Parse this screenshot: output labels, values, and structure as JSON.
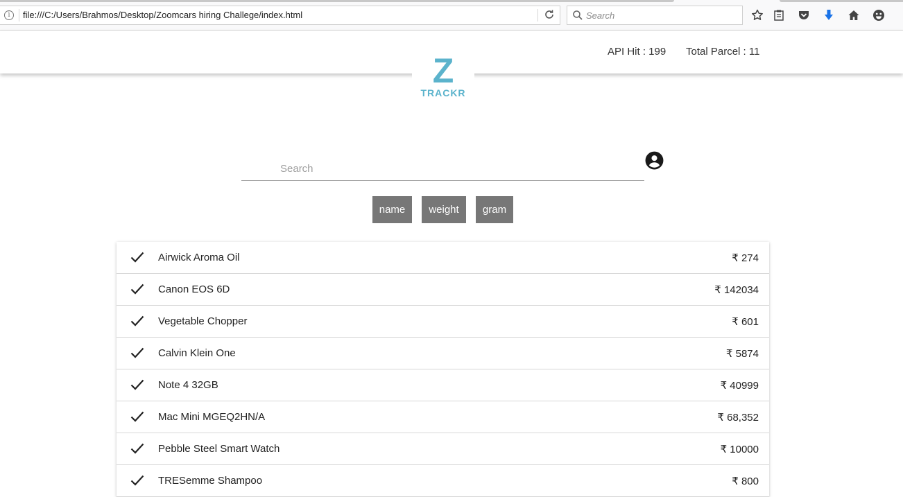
{
  "browser": {
    "url": "file:///C:/Users/Brahmos/Desktop/Zoomcars hiring Challege/index.html",
    "search_placeholder": "Search",
    "icons": [
      "info-icon",
      "reload-icon",
      "search-icon",
      "bookmark-star-icon",
      "reader-view-icon",
      "pocket-icon",
      "download-icon",
      "home-icon",
      "smiley-icon"
    ],
    "download_color": "#1a73e8"
  },
  "header": {
    "api_hit": "API Hit : 199",
    "total_parcel": "Total Parcel : 11",
    "logo_letter": "Z",
    "logo_text": "TRACKR",
    "logo_color": "#5bb3cc"
  },
  "search": {
    "placeholder": "Search",
    "icon": "account-circle-icon"
  },
  "filters": [
    {
      "label": "name"
    },
    {
      "label": "weight"
    },
    {
      "label": "gram"
    }
  ],
  "items": [
    {
      "name": "Airwick Aroma Oil",
      "price": "₹ 274"
    },
    {
      "name": "Canon EOS 6D",
      "price": "₹ 142034"
    },
    {
      "name": "Vegetable Chopper",
      "price": "₹ 601"
    },
    {
      "name": "Calvin Klein One",
      "price": "₹ 5874"
    },
    {
      "name": "Note 4 32GB",
      "price": "₹ 40999"
    },
    {
      "name": "Mac Mini MGEQ2HN/A",
      "price": "₹ 68,352"
    },
    {
      "name": "Pebble Steel Smart Watch",
      "price": "₹ 10000"
    },
    {
      "name": "TRESemme Shampoo",
      "price": "₹ 800"
    }
  ]
}
